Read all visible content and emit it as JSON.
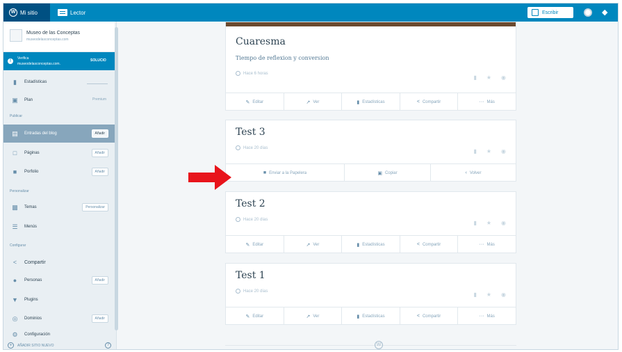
{
  "masterbar": {
    "my_site": "Mi sitio",
    "reader": "Lector",
    "write": "Escribir"
  },
  "site": {
    "title": "Museo de las Conceptas",
    "url": "museodelasconceptas.com"
  },
  "verify": {
    "line1": "Verifica",
    "line2": "museodelasconceptas.com.",
    "button": "SOLUCIO"
  },
  "sidebar": {
    "stats": "Estadísticas",
    "plan": "Plan",
    "plan_badge": "Premium",
    "section_publish": "Publicar",
    "posts": "Entradas del blog",
    "pages": "Páginas",
    "portfolio": "Porfolio",
    "section_personalize": "Personalizar",
    "themes": "Temas",
    "themes_btn": "Personalizar",
    "menus": "Menús",
    "section_configure": "Configurar",
    "share": "Compartir",
    "people": "Personas",
    "plugins": "Plugins",
    "domains": "Dominios",
    "settings": "Configuración",
    "add_label": "Añadir",
    "add_new_site": "AÑADIR SITIO NUEVO"
  },
  "posts": [
    {
      "title": "Cuaresma",
      "excerpt": "Tiempo de reflexion y conversion",
      "date": "Hace 6 horas"
    },
    {
      "title": "Test 3",
      "date": "Hace 20 días"
    },
    {
      "title": "Test 2",
      "date": "Hace 20 días"
    },
    {
      "title": "Test 1",
      "date": "Hace 20 días"
    }
  ],
  "actions": {
    "edit": "Editar",
    "view": "Ver",
    "stats": "Estadísticas",
    "share": "Compartir",
    "more": "Más"
  },
  "trash_actions": {
    "trash": "Enviar a la Papelera",
    "copy": "Copiar",
    "back": "Volver"
  },
  "colors": {
    "accent": "#0087be",
    "arrow": "#e8141b",
    "sidebar_active": "#87a6bc"
  },
  "icons": [
    "wordpress-icon",
    "reader-icon",
    "write-icon",
    "avatar-icon",
    "notifications-icon",
    "clock-icon",
    "comment-icon",
    "star-icon",
    "eye-icon",
    "pencil-icon",
    "external-link-icon",
    "stats-icon",
    "share-icon",
    "ellipsis-icon",
    "trash-icon",
    "copy-icon",
    "chevron-left-icon",
    "red-arrow-icon"
  ]
}
